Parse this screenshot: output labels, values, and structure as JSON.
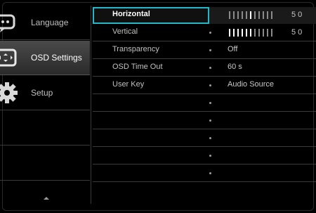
{
  "sidebar": {
    "items": [
      {
        "label": "Language",
        "icon": "chat-bubble-icon",
        "active": false
      },
      {
        "label": "OSD Settings",
        "icon": "osd-screen-icon",
        "active": true
      },
      {
        "label": "Setup",
        "icon": "gear-icon",
        "active": false
      }
    ],
    "scroll_icon": "scroll-up-arrow-icon"
  },
  "menu": {
    "rows": [
      {
        "label": "Horizontal",
        "value": "50",
        "slider_level": 0.5,
        "selected": true
      },
      {
        "label": "Vertical",
        "value": "50",
        "slider_level": 0.5,
        "selected": false
      },
      {
        "label": "Transparency",
        "value": "Off",
        "selected": false
      },
      {
        "label": "OSD Time Out",
        "value": "60 s",
        "selected": false
      },
      {
        "label": "User Key",
        "value": "Audio Source",
        "selected": false
      }
    ]
  },
  "colors": {
    "highlight": "#22b8c8",
    "background": "#000000",
    "text": "#c0c0c0"
  }
}
